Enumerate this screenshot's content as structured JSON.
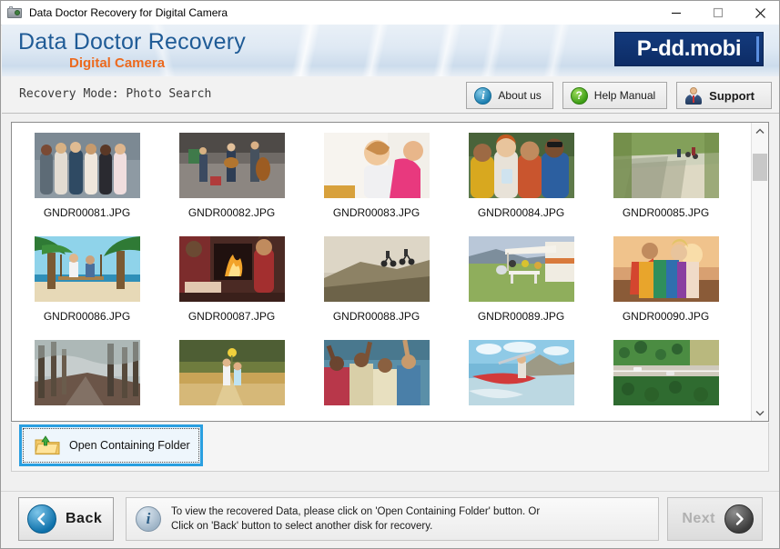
{
  "window": {
    "title": "Data Doctor Recovery for Digital Camera",
    "icon": "camera-icon",
    "minimize_label": "—",
    "maximize_label": "□",
    "close_label": "✕"
  },
  "banner": {
    "title": "Data Doctor Recovery",
    "subtitle": "Digital Camera",
    "logo": "P-dd.mobi",
    "title_color": "#1f5b96",
    "subtitle_color": "#ec6a1e",
    "logo_bg": "#133a7c"
  },
  "modebar": {
    "mode_text": "Recovery Mode: Photo Search",
    "buttons": [
      {
        "label": "About us",
        "icon": "info-icon",
        "glyph": "i"
      },
      {
        "label": "Help Manual",
        "icon": "question-icon",
        "glyph": "?"
      },
      {
        "label": "Support",
        "icon": "support-person-icon",
        "glyph": ""
      }
    ]
  },
  "grid": {
    "rows": [
      [
        {
          "name": "GNDR00081.JPG",
          "thumb": "group-of-friends-outdoors"
        },
        {
          "name": "GNDR00082.JPG",
          "thumb": "street-musicians"
        },
        {
          "name": "GNDR00083.JPG",
          "thumb": "child-in-pink"
        },
        {
          "name": "GNDR00084.JPG",
          "thumb": "friends-selfie"
        },
        {
          "name": "GNDR00085.JPG",
          "thumb": "cyclists-on-path"
        }
      ],
      [
        {
          "name": "GNDR00086.JPG",
          "thumb": "beach-swing"
        },
        {
          "name": "GNDR00087.JPG",
          "thumb": "fireplace-pajamas"
        },
        {
          "name": "GNDR00088.JPG",
          "thumb": "mountain-bikers-sunset"
        },
        {
          "name": "GNDR00089.JPG",
          "thumb": "camper-picnic"
        },
        {
          "name": "GNDR00090.JPG",
          "thumb": "friends-with-blanket"
        }
      ],
      [
        {
          "name": "",
          "thumb": "misty-forest-path"
        },
        {
          "name": "",
          "thumb": "girls-in-field"
        },
        {
          "name": "",
          "thumb": "crowd-cheering"
        },
        {
          "name": "",
          "thumb": "kayaker-on-river"
        },
        {
          "name": "",
          "thumb": "aerial-road-forest"
        }
      ]
    ],
    "scrollbar": {
      "up_arrow": "chevron-up",
      "down_arrow": "chevron-down"
    }
  },
  "open_folder": {
    "label": "Open Containing Folder",
    "icon": "folder-upload-icon",
    "focus_color": "#2a9fe0"
  },
  "footer": {
    "back_label": "Back",
    "next_label": "Next",
    "info_line1": "To view the recovered Data, please click on 'Open Containing Folder' button. Or",
    "info_line2": "Click on 'Back' button to select another disk for recovery.",
    "info_icon": "info-icon",
    "back_icon": "chevron-left-circle",
    "next_icon": "chevron-right-circle"
  }
}
